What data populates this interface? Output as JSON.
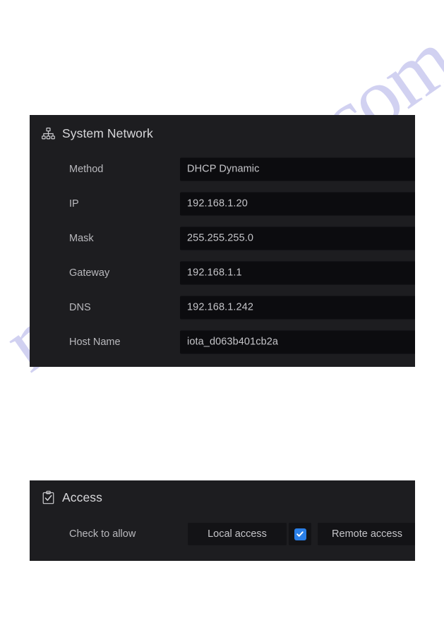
{
  "watermark": {
    "text": "manualsive.com"
  },
  "colors": {
    "page_background": "#ffffff",
    "panel_background": "#1d1d20",
    "field_background": "#0c0c0f",
    "button_background": "#131316",
    "label_text": "#b9b9bd",
    "value_text": "#c5c5c9",
    "title_text": "#d8d8db",
    "checkbox_accent": "#2a7fe8",
    "watermark_color": "#c9c9ef"
  },
  "panels": [
    {
      "id": "system-network",
      "title": "System Network",
      "icon": "network-tree-icon",
      "rows": [
        {
          "label": "Method",
          "value": "DHCP Dynamic",
          "control": "select"
        },
        {
          "label": "IP",
          "value": "192.168.1.20",
          "control": "text"
        },
        {
          "label": "Mask",
          "value": "255.255.255.0",
          "control": "text"
        },
        {
          "label": "Gateway",
          "value": "192.168.1.1",
          "control": "text"
        },
        {
          "label": "DNS",
          "value": "192.168.1.242",
          "control": "text"
        },
        {
          "label": "Host Name",
          "value": "iota_d063b401cb2a",
          "control": "text"
        }
      ]
    },
    {
      "id": "access",
      "title": "Access",
      "icon": "clipboard-check-icon",
      "row_label": "Check to allow",
      "options": [
        {
          "label": "Local access",
          "checked": true
        },
        {
          "label": "Remote access",
          "checked": true
        }
      ]
    }
  ]
}
